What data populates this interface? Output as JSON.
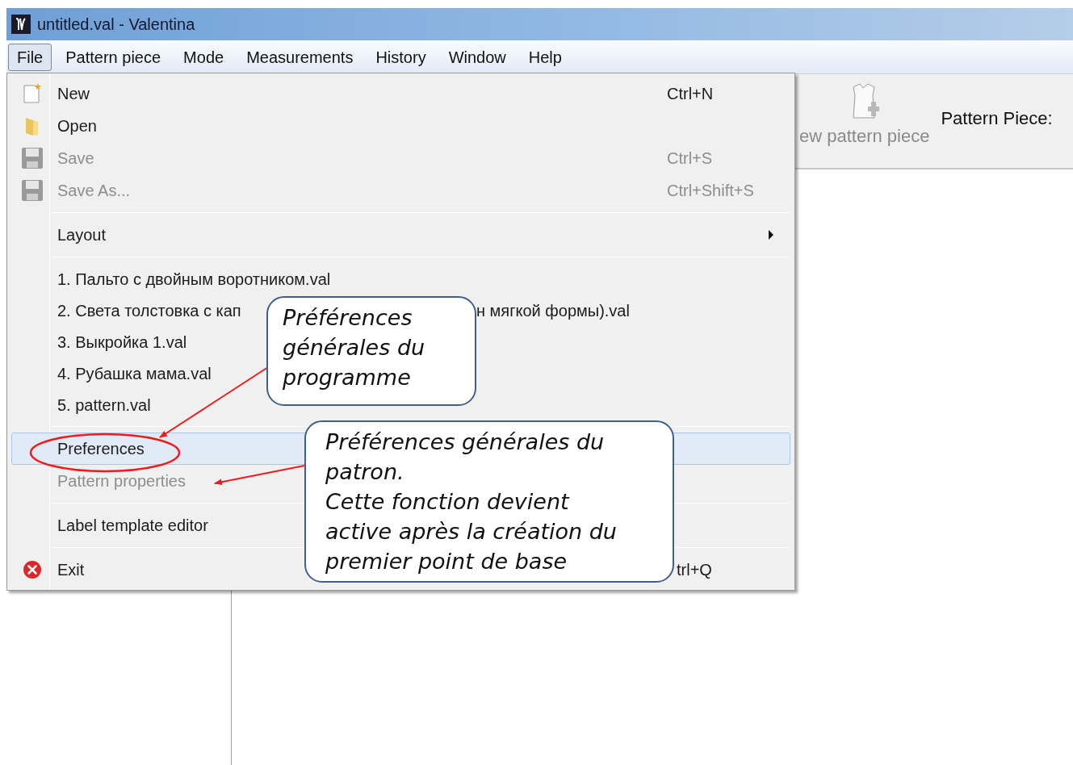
{
  "window": {
    "title": "untitled.val - Valentina"
  },
  "menubar": [
    {
      "label": "File",
      "selected": true
    },
    {
      "label": "Pattern piece",
      "selected": false
    },
    {
      "label": "Mode",
      "selected": false
    },
    {
      "label": "Measurements",
      "selected": false
    },
    {
      "label": "History",
      "selected": false
    },
    {
      "label": "Window",
      "selected": false
    },
    {
      "label": "Help",
      "selected": false
    }
  ],
  "toolbar": {
    "button_label": "ew pattern piece",
    "field_label": "Pattern Piece:"
  },
  "file_menu": [
    {
      "kind": "item",
      "label": "New",
      "shortcut": "Ctrl+N",
      "disabled": false,
      "selected": false
    },
    {
      "kind": "item",
      "label": "Open",
      "disabled": false,
      "selected": false
    },
    {
      "kind": "item",
      "label": "Save",
      "shortcut": "Ctrl+S",
      "disabled": true,
      "selected": false
    },
    {
      "kind": "item",
      "label": "Save As...",
      "shortcut": "Ctrl+Shift+S",
      "disabled": true,
      "selected": false
    },
    {
      "kind": "separator"
    },
    {
      "kind": "submenu",
      "label": "Layout",
      "disabled": false,
      "selected": false
    },
    {
      "kind": "separator"
    },
    {
      "kind": "recent",
      "label": "1. Пальто с двойным воротником.val"
    },
    {
      "kind": "recent",
      "label": "2. Света толстовка с кап",
      "label_tail": "н мягкой формы).val"
    },
    {
      "kind": "recent",
      "label": "3. Выкройка 1.val"
    },
    {
      "kind": "recent",
      "label": "4. Рубашка мама.val"
    },
    {
      "kind": "recent",
      "label": "5. pattern.val"
    },
    {
      "kind": "separator"
    },
    {
      "kind": "item",
      "label": "Preferences",
      "disabled": false,
      "selected": true
    },
    {
      "kind": "item",
      "label": "Pattern properties",
      "disabled": true,
      "selected": false
    },
    {
      "kind": "separator"
    },
    {
      "kind": "item",
      "label": "Label template editor",
      "disabled": false,
      "selected": false
    },
    {
      "kind": "separator"
    },
    {
      "kind": "item",
      "label": "Exit",
      "shortcut": "trl+Q",
      "disabled": false,
      "selected": false
    }
  ],
  "callouts": [
    {
      "text": "Préférences\ngénérales du\nprogramme"
    },
    {
      "text": "Préférences générales du\npatron.\nCette fonction devient\nactive après la création du\npremier point de base"
    }
  ]
}
